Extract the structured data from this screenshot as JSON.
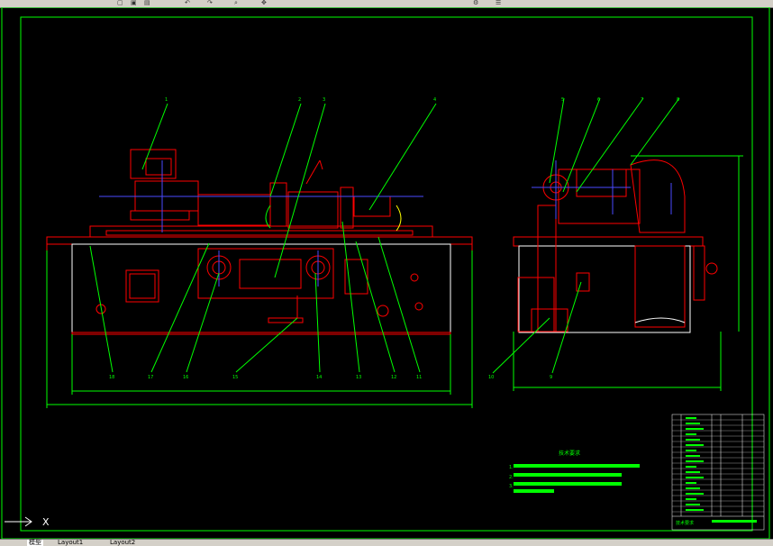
{
  "toolbar": {
    "icons": [
      "new-icon",
      "open-icon",
      "save-icon",
      "undo-icon",
      "redo-icon",
      "zoom-icon",
      "pan-icon",
      "properties-icon"
    ]
  },
  "drawing": {
    "callouts_front": [
      "1",
      "2",
      "3",
      "4",
      "18",
      "17",
      "16",
      "15",
      "14",
      "13",
      "12",
      "11"
    ],
    "callouts_side": [
      "5",
      "6",
      "7",
      "8",
      "10",
      "9"
    ],
    "tech_title": "技术要求",
    "tech_items": [
      "1.",
      "2.",
      "3."
    ],
    "title_block_label": "技术要求"
  },
  "command": {
    "ucs_x": "X"
  },
  "tabs": [
    {
      "label": "模型",
      "active": true
    },
    {
      "label": "Layout1",
      "active": false
    },
    {
      "label": "Layout2",
      "active": false
    }
  ],
  "colors": {
    "background": "#000000",
    "frame": "#00ff00",
    "machine": "#ff0000",
    "leader": "#00ff00",
    "fill_green": "#00ff00",
    "detail": "#ffffff",
    "axis": "#4a4aff"
  }
}
